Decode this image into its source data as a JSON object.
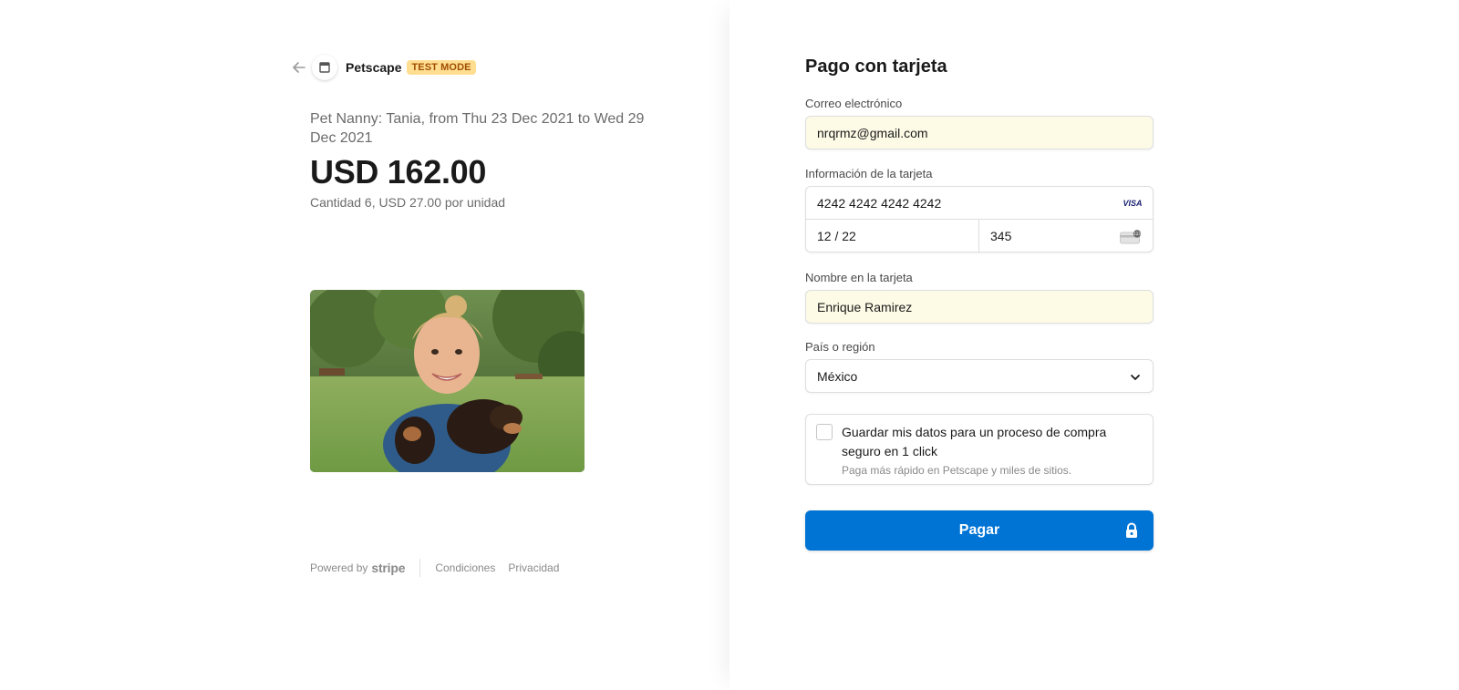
{
  "header": {
    "merchant_name": "Petscape",
    "test_badge": "TEST MODE",
    "back_icon": "arrow-left-icon",
    "logo_icon": "store-icon"
  },
  "product": {
    "description": "Pet Nanny: Tania, from Thu 23 Dec 2021 to Wed 29 Dec 2021",
    "price": "USD 162.00",
    "quantity_note": "Cantidad 6, USD 27.00 por unidad",
    "image_alt": "woman-with-dachshunds-photo"
  },
  "footer": {
    "powered_by": "Powered by",
    "brand": "stripe",
    "terms": "Condiciones",
    "privacy": "Privacidad"
  },
  "form": {
    "title": "Pago con tarjeta",
    "email_label": "Correo electrónico",
    "email_value": "nrqrmz@gmail.com",
    "card_label": "Información de la tarjeta",
    "card_number": "4242 4242 4242 4242",
    "card_brand": "VISA",
    "card_expiry": "12 / 22",
    "card_cvc": "345",
    "name_label": "Nombre en la tarjeta",
    "name_value": "Enrique Ramirez",
    "country_label": "País o región",
    "country_value": "México",
    "save_title": "Guardar mis datos para un proceso de compra seguro en 1 click",
    "save_subtitle": "Paga más rápido en Petscape y miles de sitios.",
    "pay_label": "Pagar"
  },
  "colors": {
    "accent": "#0074d4",
    "badge_bg": "#ffde92",
    "badge_text": "#a04e00",
    "autofill_bg": "#fdfbe6"
  }
}
